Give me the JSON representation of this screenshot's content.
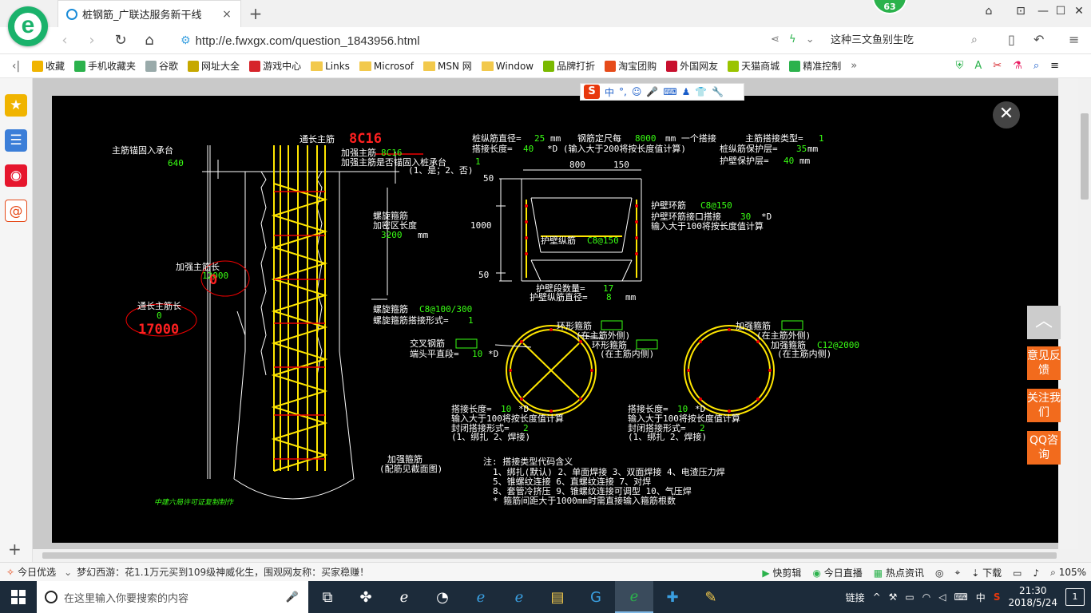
{
  "browser": {
    "logo_letter": "e",
    "tab": {
      "title": "桩钢筋_广联达服务新干线",
      "close": "×"
    },
    "new_tab": "+",
    "badge": "63",
    "window": {
      "skin": "⌂",
      "restore_tabs": "⊡",
      "minimize": "—",
      "maximize": "☐",
      "close": "✕"
    }
  },
  "addressbar": {
    "back": "‹",
    "forward": "›",
    "reload": "↻",
    "home": "⌂",
    "url": "http://e.fwxgx.com/question_1843956.html",
    "search_text": "这种三文鱼别生吃"
  },
  "bookmarks": {
    "collapse": "‹|",
    "items": [
      {
        "label": "收藏",
        "icon": "star-icon",
        "color": "#f0b400"
      },
      {
        "label": "手机收藏夹",
        "icon": "phone-icon",
        "color": "#2bb24c"
      },
      {
        "label": "谷歌",
        "icon": "page-icon",
        "color": "#9aa"
      },
      {
        "label": "网址大全",
        "icon": "globe-icon",
        "color": "#c6a800"
      },
      {
        "label": "游戏中心",
        "icon": "game-icon",
        "color": "#d6242a"
      },
      {
        "label": "Links",
        "icon": "folder-icon",
        "color": "#f2c94c"
      },
      {
        "label": "Microsof",
        "icon": "folder-icon",
        "color": "#f2c94c"
      },
      {
        "label": "MSN 网",
        "icon": "folder-icon",
        "color": "#f2c94c"
      },
      {
        "label": "Window",
        "icon": "folder-icon",
        "color": "#f2c94c"
      },
      {
        "label": "品牌打折",
        "icon": "leaf-icon",
        "color": "#7ab900"
      },
      {
        "label": "淘宝团购",
        "icon": "tao-icon",
        "color": "#e64b1a"
      },
      {
        "label": "外国网友",
        "icon": "bookmark-icon",
        "color": "#c8102e"
      },
      {
        "label": "天猫商城",
        "icon": "leaf-icon",
        "color": "#9ac400"
      },
      {
        "label": "精准控制",
        "icon": "chat-icon",
        "color": "#2bb24c"
      }
    ],
    "more": "»"
  },
  "cad": {
    "left": {
      "zhujin_label": "主筋锚固入承台",
      "zhujin_value": "640",
      "tongchang_top": "通长主筋",
      "tongchang_red": "8C16",
      "jiaqiang_label": "加强主筋",
      "jiaqiang_value": "8C16",
      "maogu_label": "加强主筋是否锚固入桩承台",
      "maogu_value": "1",
      "maogu_opts": "(1、是；2、否)",
      "luoxuan_label1": "螺旋箍筋",
      "luoxuan_label2": "加密区长度",
      "luoxuan_value": "3200",
      "luoxuan_unit": "mm",
      "jq_len_label": "加强主筋长",
      "jq_len_value": "12000",
      "jq_len_red": "0",
      "tc_len_label": "通长主筋长",
      "tc_len_value": "0",
      "tc_len_red": "17000",
      "lx_gujin_label": "螺旋箍筋",
      "lx_gujin_value": "C8@100/300",
      "lx_dajie_label": "螺旋箍筋搭接形式=",
      "lx_dajie_value": "1",
      "jq_gu_label": "加强箍筋",
      "jq_gu_note": "(配筋见截面图)",
      "watermark": "中建六局许可证复制制作"
    },
    "top": {
      "line1_a": "桩纵筋直径=",
      "line1_b": "25",
      "line1_c": "mm",
      "line1_d": "钢筋定尺每",
      "line1_e": "8000",
      "line1_f": "mm 一个搭接",
      "line1_g": "主筋搭接类型=",
      "line1_h": "1",
      "line2_a": "搭接长度=",
      "line2_b": "40",
      "line2_c": "*D (输入大于200将按长度值计算)",
      "line2_d": "桩纵筋保护层=",
      "line2_e": "35",
      "line2_f": "mm",
      "line3_a": "护壁保护层=",
      "line3_b": "40",
      "line3_c": "mm"
    },
    "wall": {
      "dim_800": "800",
      "dim_150": "150",
      "dim_50_top": "50",
      "dim_1000": "1000",
      "dim_50_bot": "50",
      "huanjin_label": "护壁环筋",
      "huanjin_value": "C8@150",
      "jietou_label": "护壁环筋接口搭接",
      "jietou_value": "30",
      "jietou_unit": "*D",
      "jietou_note": "输入大于100将按长度值计算",
      "zongjin_label": "护壁纵筋",
      "zongjin_value": "C8@150",
      "duan_label": "护壁段数量=",
      "duan_value": "17",
      "zj_d_label": "护壁纵筋直径=",
      "zj_d_value": "8",
      "zj_d_unit": "mm"
    },
    "section1": {
      "huanxing": "环形箍筋",
      "outside": "(在主筋外侧)",
      "huanxing2": "环形箍筋",
      "inside": "(在主筋内侧)",
      "jiaocha": "交叉钢筋",
      "duantou": "端头平直段=",
      "duantou_value": "10",
      "duantou_unit": "*D",
      "dajie": "搭接长度=",
      "dajie_value": "10",
      "dajie_unit": "*D",
      "note": "输入大于100将按长度值计算",
      "fengbi": "封闭搭接形式=",
      "fengbi_value": "2",
      "opts": "(1、绑扎  2、焊接)"
    },
    "section2": {
      "jiaqiang": "加强箍筋",
      "outside": "(在主筋外侧)",
      "jiaqiang2": "加强箍筋",
      "value": "C12@2000",
      "inside": "(在主筋内侧)",
      "dajie": "搭接长度=",
      "dajie_value": "10",
      "dajie_unit": "*D",
      "note": "输入大于100将按长度值计算",
      "fengbi": "封闭搭接形式=",
      "fengbi_value": "2",
      "opts": "(1、绑扎  2、焊接)"
    },
    "legend": {
      "title": "注: 搭接类型代码含义",
      "line1": "1、绑扎(默认)    2、单面焊接    3、双面焊接    4、电渣压力焊",
      "line2": "5、锥螺纹连接    6、直螺纹连接    7、对焊",
      "line3": "8、套管冷挤压    9、锥螺纹连接可调型    10、气压焊",
      "line4": "* 箍筋间距大于1000mm时需直接输入箍筋根数"
    }
  },
  "ime": {
    "logo": "S",
    "lang": "中",
    "punct": "°,",
    "emoji": "☺",
    "voice": "🎤",
    "keyboard": "⌨",
    "user": "♟",
    "skin": "👕",
    "tools": "🔧"
  },
  "viewer": {
    "close": "✕"
  },
  "float": {
    "top": "︿",
    "feedback": "意见反馈",
    "follow": "关注我们",
    "qq": "QQ咨询"
  },
  "statusbar": {
    "today": "今日优选",
    "news": "梦幻西游：花1.1万元买到109级神威化生，围观网友称：买家稳赚！",
    "kuaijianji": "快剪辑",
    "live": "今日直播",
    "hot": "热点资讯",
    "download": "下载",
    "zoom": "105%"
  },
  "taskbar": {
    "search_placeholder": "在这里输入你要搜索的内容",
    "tray_link": "链接",
    "ime": "中",
    "time": "21:30",
    "date": "2018/5/24",
    "notify": "1"
  }
}
